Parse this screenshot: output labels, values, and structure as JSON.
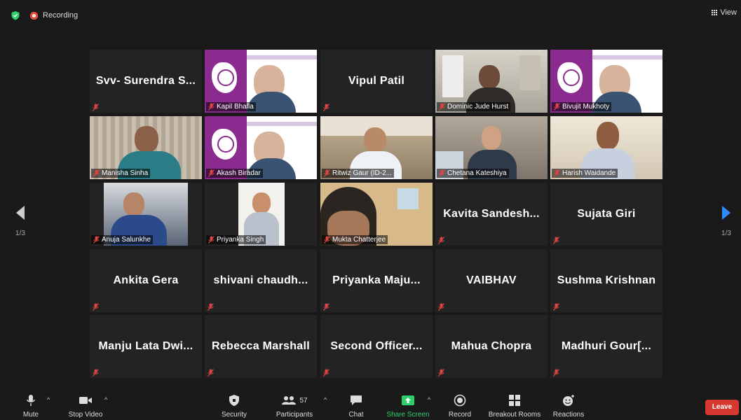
{
  "top": {
    "recording_label": "Recording",
    "view_label": "View"
  },
  "pagination": {
    "left": "1/3",
    "right": "1/3"
  },
  "participants": [
    {
      "name": "Svv- Surendra S...",
      "video": false
    },
    {
      "name": "Kapil Bhalla",
      "video": true,
      "active": true,
      "bg": "purple"
    },
    {
      "name": "Vipul Patil",
      "video": false,
      "no_mic": true
    },
    {
      "name": "Dominic Jude Hurst",
      "video": true,
      "bg": "office"
    },
    {
      "name": "Bivujit Mukhoty",
      "video": true,
      "bg": "purple"
    },
    {
      "name": "Manisha Sinha",
      "video": true,
      "bg": "curtain"
    },
    {
      "name": "Akash Biradar",
      "video": true,
      "bg": "purple"
    },
    {
      "name": "Ritwiz Gaur (ID-2...",
      "video": true,
      "bg": "room"
    },
    {
      "name": "Chetana Kateshiya",
      "video": true,
      "bg": "room2"
    },
    {
      "name": "Harish Waidande",
      "video": true,
      "bg": "wall"
    },
    {
      "name": "Anuja Salunkhe",
      "video": true,
      "bg": "home"
    },
    {
      "name": "Priyanka Singh",
      "video": true,
      "bg": "white"
    },
    {
      "name": "Mukta Chatterjee",
      "video": true,
      "bg": "closeup"
    },
    {
      "name": "Kavita Sandesh...",
      "video": false
    },
    {
      "name": "Sujata Giri",
      "video": false
    },
    {
      "name": "Ankita Gera",
      "video": false
    },
    {
      "name": "shivani chaudh...",
      "video": false
    },
    {
      "name": "Priyanka Maju...",
      "video": false
    },
    {
      "name": "VAIBHAV",
      "video": false
    },
    {
      "name": "Sushma Krishnan",
      "video": false
    },
    {
      "name": "Manju Lata Dwi...",
      "video": false
    },
    {
      "name": "Rebecca Marshall",
      "video": false
    },
    {
      "name": "Second Officer...",
      "video": false
    },
    {
      "name": "Mahua Chopra",
      "video": false
    },
    {
      "name": "Madhuri Gour[...",
      "video": false
    }
  ],
  "toolbar": {
    "mute": "Mute",
    "stop_video": "Stop Video",
    "security": "Security",
    "participants": "Participants",
    "participants_count": "57",
    "chat": "Chat",
    "share_screen": "Share Screen",
    "record": "Record",
    "breakout_rooms": "Breakout Rooms",
    "reactions": "Reactions",
    "leave": "Leave"
  },
  "colors": {
    "accent_green": "#2fcf6c",
    "leave_red": "#d6392f",
    "active_border": "#d9e26a",
    "mic_off_red": "#e04444"
  }
}
